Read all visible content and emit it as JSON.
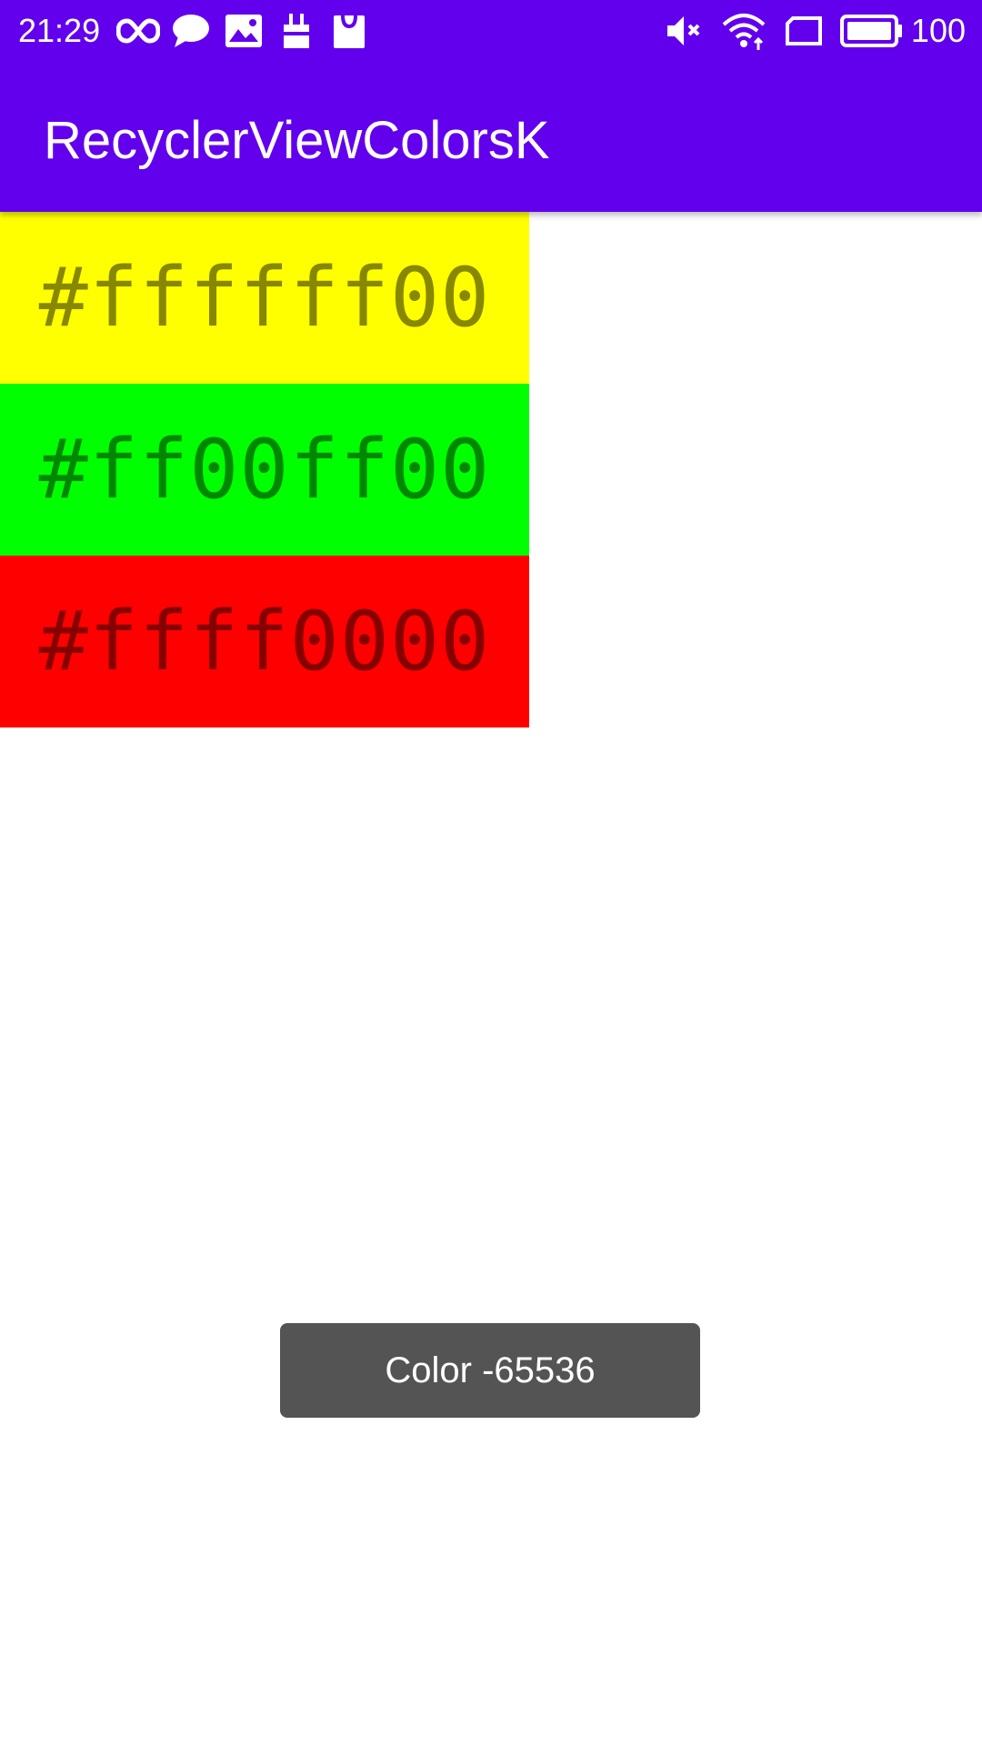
{
  "status_bar": {
    "time": "21:29",
    "battery_percent": "100",
    "left_icons": [
      "infinity-icon",
      "chat-bubble-icon",
      "image-icon",
      "cart-icon",
      "shopping-bag-icon"
    ],
    "right_icons": [
      "volume-muted-icon",
      "wifi-icon",
      "screen-icon",
      "battery-icon"
    ]
  },
  "app_bar": {
    "title": "RecyclerViewColorsK",
    "color": "#6200ee"
  },
  "color_list": {
    "items": [
      {
        "label": "#ffffff00",
        "background": "#ffff00"
      },
      {
        "label": "#ff00ff00",
        "background": "#00ff00"
      },
      {
        "label": "#ffff0000",
        "background": "#ff0000"
      }
    ]
  },
  "toast": {
    "message": "Color -65536"
  }
}
